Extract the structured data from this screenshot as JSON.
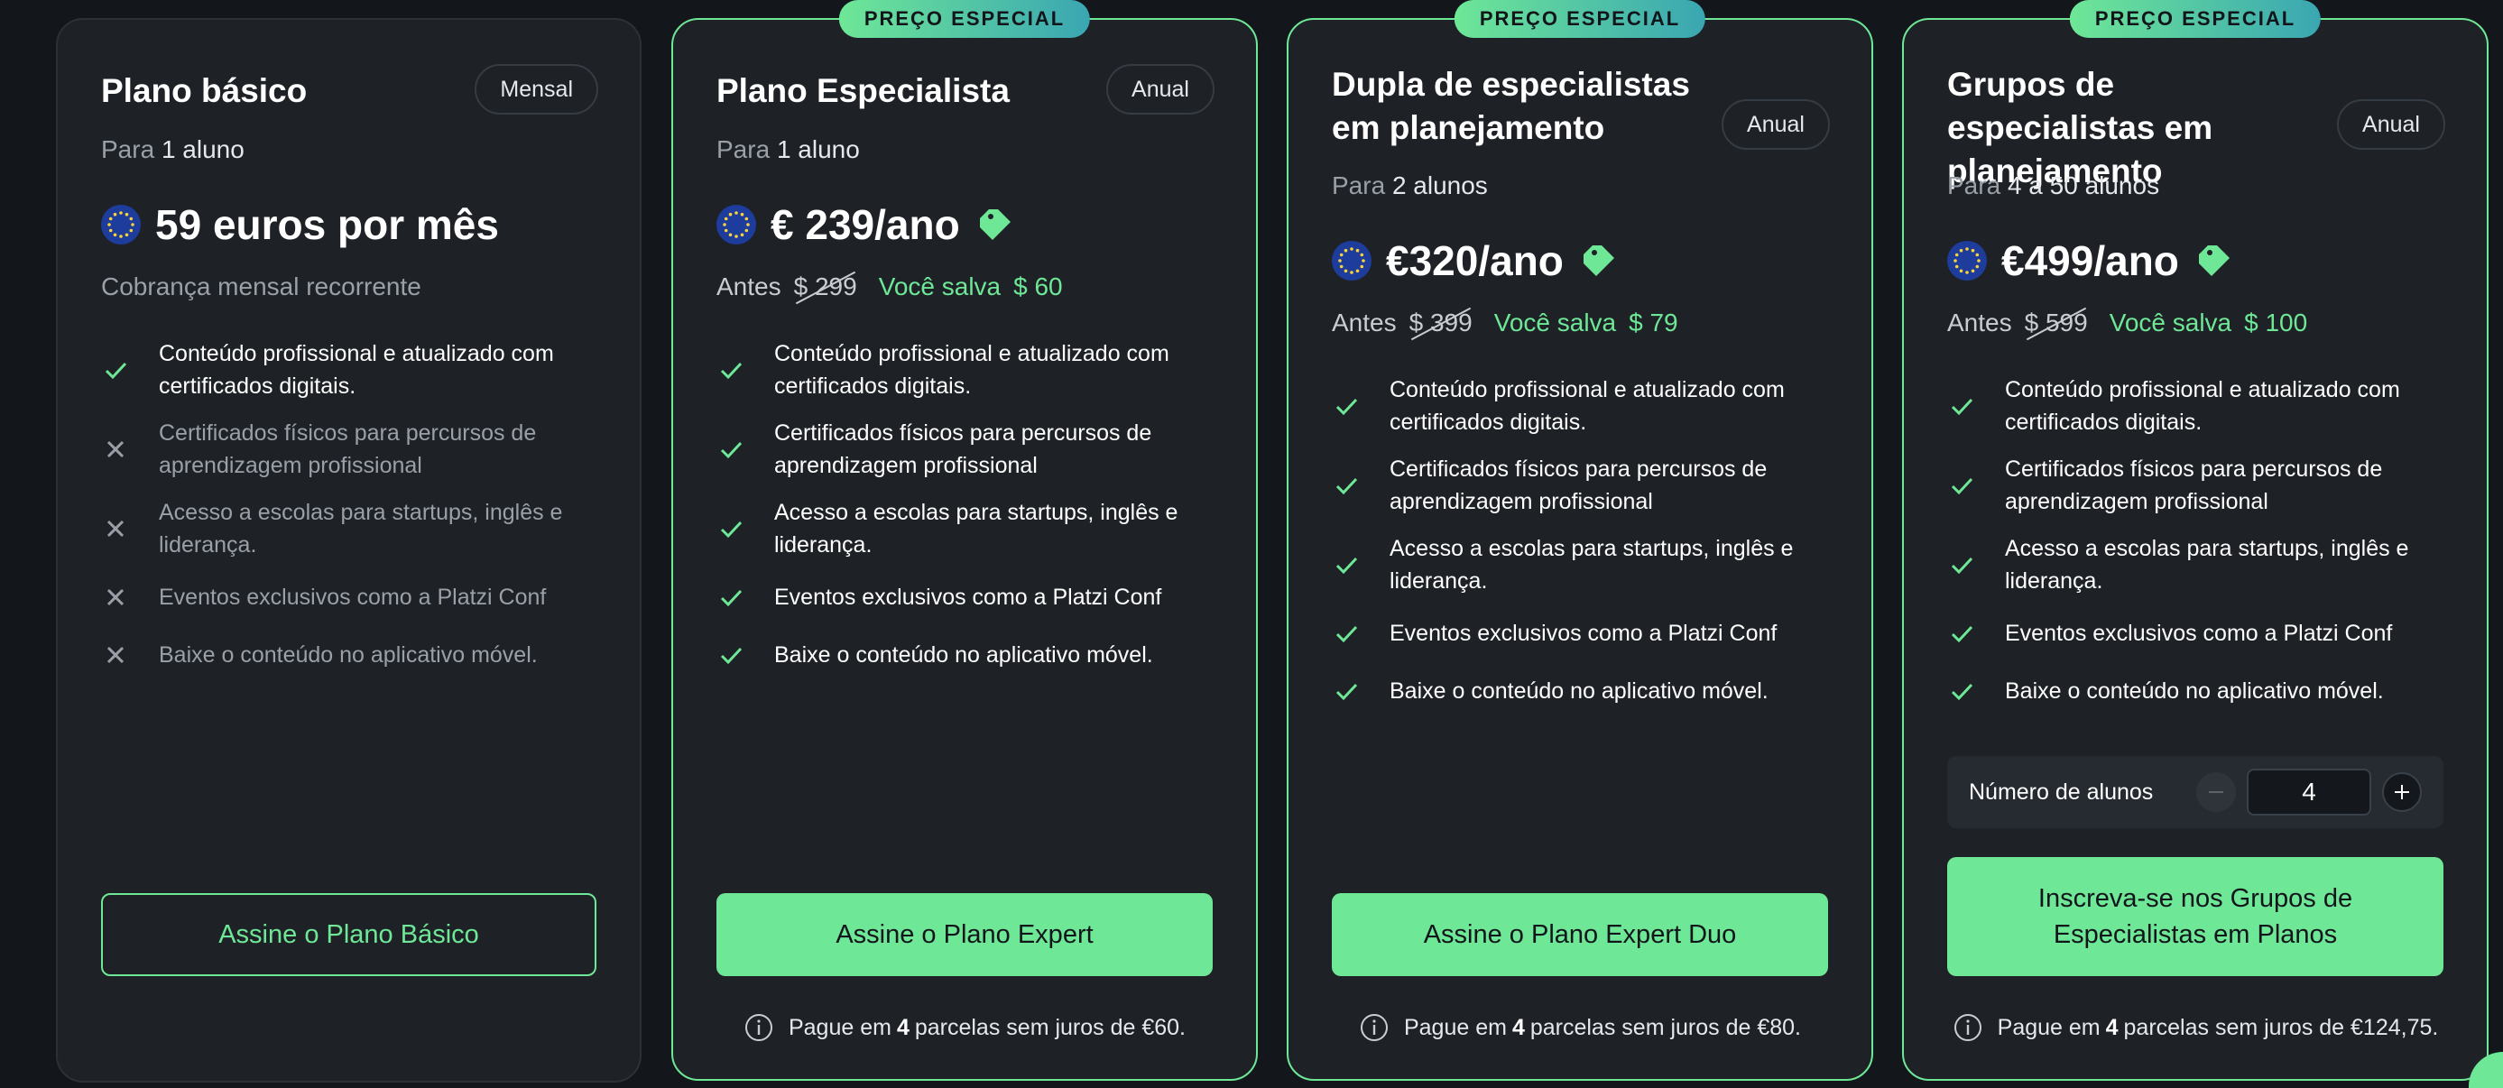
{
  "colors": {
    "accent": "#6ee797",
    "card": "#1e2227",
    "background": "#13161b",
    "muted": "#9aa0a8"
  },
  "plans": [
    {
      "title": "Plano básico",
      "billing": "Mensal",
      "for_prefix": "Para",
      "for_value": "1 aluno",
      "price": "59 euros por mês",
      "recurring": "Cobrança mensal recorrente",
      "features": [
        {
          "text": "Conteúdo profissional e atualizado com certificados digitais.",
          "included": true
        },
        {
          "text": "Certificados físicos para percursos de aprendizagem profissional",
          "included": false
        },
        {
          "text": "Acesso a escolas para startups, inglês e liderança.",
          "included": false
        },
        {
          "text": "Eventos exclusivos como a Platzi Conf",
          "included": false
        },
        {
          "text": "Baixe o conteúdo no aplicativo móvel.",
          "included": false
        }
      ],
      "cta": "Assine o Plano Básico"
    },
    {
      "badge": "PREÇO ESPECIAL",
      "title": "Plano Especialista",
      "billing": "Anual",
      "for_prefix": "Para",
      "for_value": "1 aluno",
      "price": "€ 239/ano",
      "before_label": "Antes",
      "before_price": "$ 299",
      "save_label": "Você salva",
      "save_amount": "$ 60",
      "features": [
        {
          "text": "Conteúdo profissional e atualizado com certificados digitais.",
          "included": true
        },
        {
          "text": "Certificados físicos para percursos de aprendizagem profissional",
          "included": true
        },
        {
          "text": "Acesso a escolas para startups, inglês e liderança.",
          "included": true
        },
        {
          "text": "Eventos exclusivos como a Platzi Conf",
          "included": true
        },
        {
          "text": "Baixe o conteúdo no aplicativo móvel.",
          "included": true
        }
      ],
      "cta": "Assine o Plano Expert",
      "installments_pre": "Pague em",
      "installments_count": "4",
      "installments_post": "parcelas sem juros de €60."
    },
    {
      "badge": "PREÇO ESPECIAL",
      "title": "Dupla de especialistas em planejamento",
      "billing": "Anual",
      "for_prefix": "Para",
      "for_value": "2 alunos",
      "price": "€320/ano",
      "before_label": "Antes",
      "before_price": "$ 399",
      "save_label": "Você salva",
      "save_amount": "$ 79",
      "features": [
        {
          "text": "Conteúdo profissional e atualizado com certificados digitais.",
          "included": true
        },
        {
          "text": "Certificados físicos para percursos de aprendizagem profissional",
          "included": true
        },
        {
          "text": "Acesso a escolas para startups, inglês e liderança.",
          "included": true
        },
        {
          "text": "Eventos exclusivos como a Platzi Conf",
          "included": true
        },
        {
          "text": "Baixe o conteúdo no aplicativo móvel.",
          "included": true
        }
      ],
      "cta": "Assine o Plano Expert Duo",
      "installments_pre": "Pague em",
      "installments_count": "4",
      "installments_post": "parcelas sem juros de €80."
    },
    {
      "badge": "PREÇO ESPECIAL",
      "title": "Grupos de especialistas em planejamento",
      "billing": "Anual",
      "for_prefix": "Para",
      "for_value": "4 a 50 alunos",
      "price": "€499/ano",
      "before_label": "Antes",
      "before_price": "$ 599",
      "save_label": "Você salva",
      "save_amount": "$ 100",
      "features": [
        {
          "text": "Conteúdo profissional e atualizado com certificados digitais.",
          "included": true
        },
        {
          "text": "Certificados físicos para percursos de aprendizagem profissional",
          "included": true
        },
        {
          "text": "Acesso a escolas para startups, inglês e liderança.",
          "included": true
        },
        {
          "text": "Eventos exclusivos como a Platzi Conf",
          "included": true
        },
        {
          "text": "Baixe o conteúdo no aplicativo móvel.",
          "included": true
        }
      ],
      "counter_label": "Número de alunos",
      "counter_value": "4",
      "cta": "Inscreva-se nos Grupos de Especialistas em Planos",
      "installments_pre": "Pague em",
      "installments_count": "4",
      "installments_post": "parcelas sem juros de €124,75."
    }
  ]
}
